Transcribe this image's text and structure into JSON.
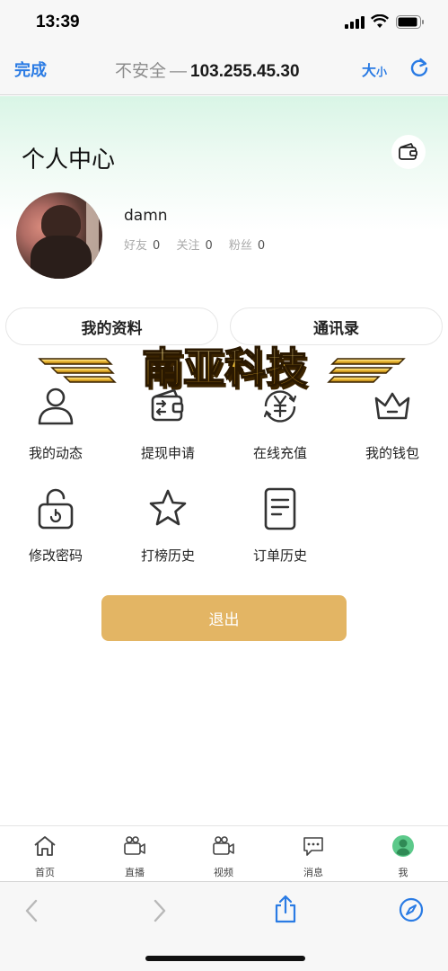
{
  "status_bar": {
    "time": "13:39"
  },
  "browser": {
    "done_label": "完成",
    "insecure_label": "不安全",
    "dash": "—",
    "host": "103.255.45.30",
    "text_size_big": "大",
    "text_size_small": "小"
  },
  "page": {
    "title": "个人中心"
  },
  "profile": {
    "username": "damn",
    "stats": [
      {
        "label": "好友",
        "value": "0"
      },
      {
        "label": "关注",
        "value": "0"
      },
      {
        "label": "粉丝",
        "value": "0"
      }
    ]
  },
  "pills": {
    "profile": "我的资料",
    "contacts": "通讯录"
  },
  "watermark": "南亚科技",
  "grid": [
    {
      "label": "我的动态",
      "icon": "user-icon"
    },
    {
      "label": "提现申请",
      "icon": "withdraw-wallet-icon"
    },
    {
      "label": "在线充值",
      "icon": "yuan-recharge-icon"
    },
    {
      "label": "我的钱包",
      "icon": "crown-icon"
    },
    {
      "label": "修改密码",
      "icon": "lock-icon"
    },
    {
      "label": "打榜历史",
      "icon": "star-icon"
    },
    {
      "label": "订单历史",
      "icon": "document-icon"
    }
  ],
  "logout_label": "退出",
  "tabs": [
    {
      "label": "首页",
      "icon": "home-icon"
    },
    {
      "label": "直播",
      "icon": "video-camera-icon"
    },
    {
      "label": "视频",
      "icon": "video-camera-icon"
    },
    {
      "label": "消息",
      "icon": "message-icon"
    },
    {
      "label": "我",
      "icon": "profile-icon"
    }
  ],
  "colors": {
    "accent_blue": "#2a7be4",
    "logout_gold": "#e3b564",
    "header_mint": "#d9f5e6",
    "active_tab_green": "#5cc98a"
  }
}
